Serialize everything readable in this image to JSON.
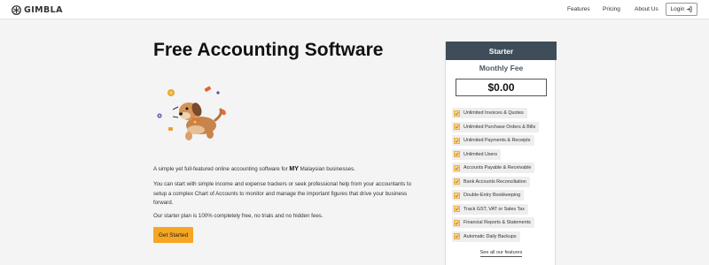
{
  "header": {
    "brand": "GIMBLA",
    "nav": [
      "Features",
      "Pricing",
      "About Us"
    ],
    "login_label": "Login"
  },
  "hero": {
    "title": "Free Accounting Software",
    "p1_before": "A simple yet full-featured online accounting software for",
    "p1_flag": "MY",
    "p1_after": "Malaysian businesses.",
    "p2": "You can start with simple income and expense trackers or seek professional help from your accountants to setup a complex Chart of Accounts to monitor and manage the important figures that drive your business forward.",
    "p3": "Our starter plan is 100% completely free, no trials and no hidden fees.",
    "cta_label": "Get Started"
  },
  "plan": {
    "name": "Starter",
    "fee_label": "Monthly Fee",
    "price": "$0.00",
    "features": [
      "Unlimited Invoices & Quotes",
      "Unlimited Purchase Orders & Bills",
      "Unlimited Payments & Receipts",
      "Unlimited Users",
      "Accounts Payable & Receivable",
      "Bank Accounts Reconciliation",
      "Double-Entry Bookkeeping",
      "Track GST, VAT or Sales Tax",
      "Financial Reports & Statements",
      "Automatic Daily Backups"
    ],
    "see_all_label": "See all our features"
  },
  "colors": {
    "cta": "#f5a623",
    "card_header": "#3e4d59",
    "check_fill": "#f7d594"
  }
}
